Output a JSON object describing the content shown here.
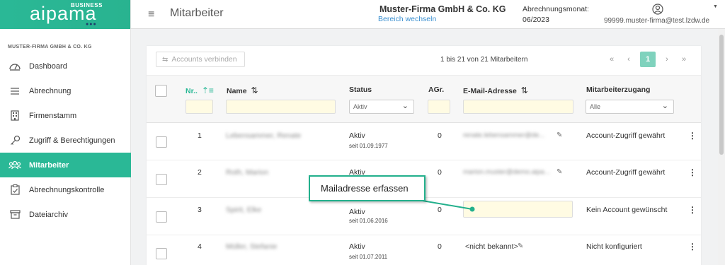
{
  "logo": {
    "brand": "aipama",
    "badge": "BUSINESS",
    "dots": "●●●"
  },
  "sidebar": {
    "company": "MUSTER-FIRMA GMBH & CO. KG",
    "items": [
      {
        "label": "Dashboard",
        "icon": "dashboard-icon"
      },
      {
        "label": "Abrechnung",
        "icon": "list-icon"
      },
      {
        "label": "Firmenstamm",
        "icon": "building-icon"
      },
      {
        "label": "Zugriff & Berechtigungen",
        "icon": "key-icon"
      },
      {
        "label": "Mitarbeiter",
        "icon": "users-icon",
        "active": true
      },
      {
        "label": "Abrechnungskontrolle",
        "icon": "clipboard-check-icon"
      },
      {
        "label": "Dateiarchiv",
        "icon": "archive-icon"
      }
    ]
  },
  "header": {
    "title": "Mitarbeiter",
    "firm": "Muster-Firma GmbH & Co. KG",
    "switch_label": "Bereich wechseln",
    "month_label": "Abrechnungsmonat:",
    "month_value": "06/2023",
    "user_email": "99999.muster-firma@test.lzdw.de"
  },
  "toolbar": {
    "connect_label": "Accounts verbinden",
    "range_text": "1 bis 21 von 21 Mitarbeitern",
    "pager": {
      "first": "«",
      "prev": "‹",
      "current": "1",
      "next": "›",
      "last": "»"
    }
  },
  "table": {
    "headers": {
      "nr": "Nr..",
      "name": "Name",
      "status": "Status",
      "agr": "AGr.",
      "email": "E-Mail-Adresse",
      "access": "Mitarbeiterzugang"
    },
    "filters": {
      "status": "Aktiv",
      "access": "Alle"
    },
    "rows": [
      {
        "nr": "1",
        "name": "Lebensammer, Renate",
        "status": "Aktiv",
        "since": "seit 01.09.1977",
        "agr": "0",
        "email": "renate.lebensammer@de...",
        "access": "Account-Zugriff gewährt"
      },
      {
        "nr": "2",
        "name": "Roth, Marion",
        "status": "Aktiv",
        "since": "",
        "agr": "0",
        "email": "marion.muster@demo.aipa...",
        "access": "Account-Zugriff gewährt"
      },
      {
        "nr": "3",
        "name": "Spirit, Elke",
        "status": "Aktiv",
        "since": "seit 01.06.2016",
        "agr": "0",
        "email": "",
        "access": "Kein Account gewünscht"
      },
      {
        "nr": "4",
        "name": "Müller, Stefanie",
        "status": "Aktiv",
        "since": "seit 01.07.2011",
        "agr": "0",
        "email": "<nicht bekannt>",
        "access": "Nicht konfiguriert"
      }
    ]
  },
  "callout": {
    "text": "Mailadresse erfassen"
  },
  "colors": {
    "accent": "#2ab896",
    "filter_bg": "#fffbe3",
    "link": "#3a8fd0"
  }
}
